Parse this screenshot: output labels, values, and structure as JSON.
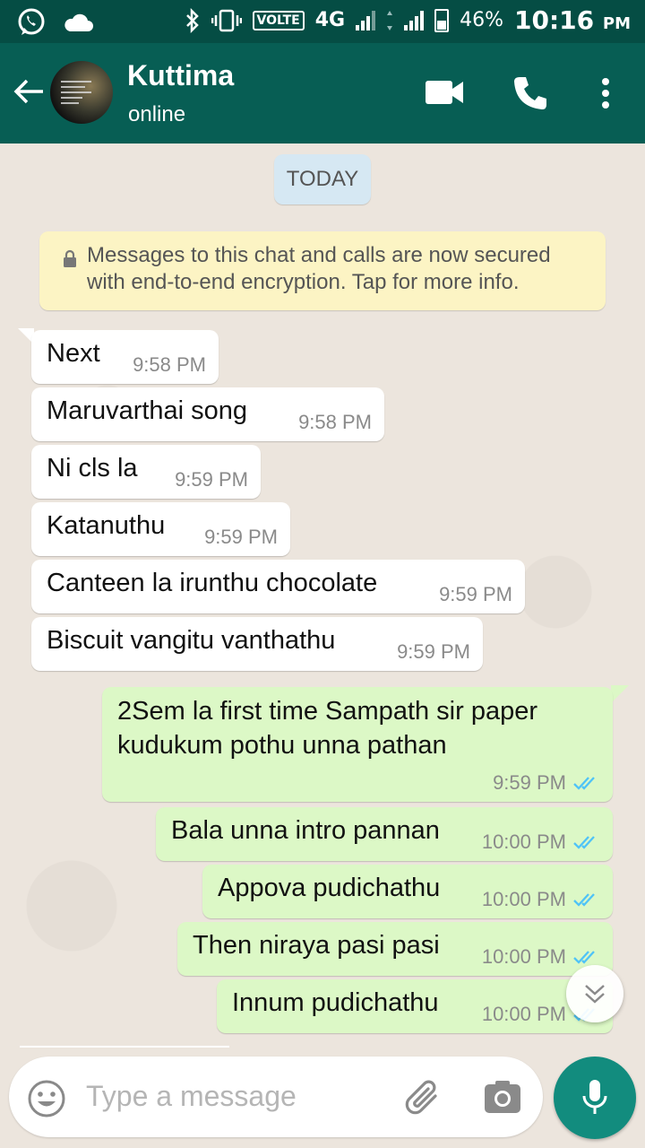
{
  "status_bar": {
    "network": "4G",
    "volte": "VOLTE",
    "battery_percent": "46%",
    "time": "10:16",
    "time_suffix": "PM"
  },
  "header": {
    "contact_name": "Kuttima",
    "contact_status": "online"
  },
  "chat": {
    "date_label": "TODAY",
    "encryption_notice_line1": "Messages to this chat and calls are now secured",
    "encryption_notice_line2": "with end-to-end encryption. Tap for more info.",
    "messages": [
      {
        "direction": "in",
        "text": "Next",
        "time": "9:58 PM"
      },
      {
        "direction": "in",
        "text": "Maruvarthai song",
        "time": "9:58 PM"
      },
      {
        "direction": "in",
        "text": "Ni cls la",
        "time": "9:59 PM"
      },
      {
        "direction": "in",
        "text": "Katanuthu",
        "time": "9:59 PM"
      },
      {
        "direction": "in",
        "text": "Canteen la irunthu chocolate",
        "time": "9:59 PM"
      },
      {
        "direction": "in",
        "text": "Biscuit vangitu vanthathu",
        "time": "9:59 PM"
      },
      {
        "direction": "out",
        "text_line1": "2Sem la first time Sampath sir paper",
        "text_line2": "kudukum pothu unna pathan",
        "time": "9:59 PM",
        "status": "read"
      },
      {
        "direction": "out",
        "text": "Bala unna intro pannan",
        "time": "10:00 PM",
        "status": "read"
      },
      {
        "direction": "out",
        "text": "Appova pudichathu",
        "time": "10:00 PM",
        "status": "read"
      },
      {
        "direction": "out",
        "text": "Then niraya pasi pasi",
        "time": "10:00 PM",
        "status": "read"
      },
      {
        "direction": "out",
        "text": "Innum pudichathu",
        "time": "10:00 PM",
        "status": "read"
      }
    ]
  },
  "input": {
    "placeholder": "Type a message"
  },
  "colors": {
    "header": "#075e54",
    "status_bar": "#054d44",
    "incoming_bubble": "#ffffff",
    "outgoing_bubble": "#dcf8c6",
    "read_ticks": "#4fc3f7",
    "mic_button": "#128c7e"
  },
  "icons": {
    "back": "arrow-left-icon",
    "video": "video-camera-icon",
    "call": "phone-icon",
    "menu": "more-vert-icon",
    "emoji": "smiley-icon",
    "attach": "paperclip-icon",
    "camera": "camera-icon",
    "mic": "microphone-icon",
    "scroll": "double-chevron-down-icon"
  }
}
